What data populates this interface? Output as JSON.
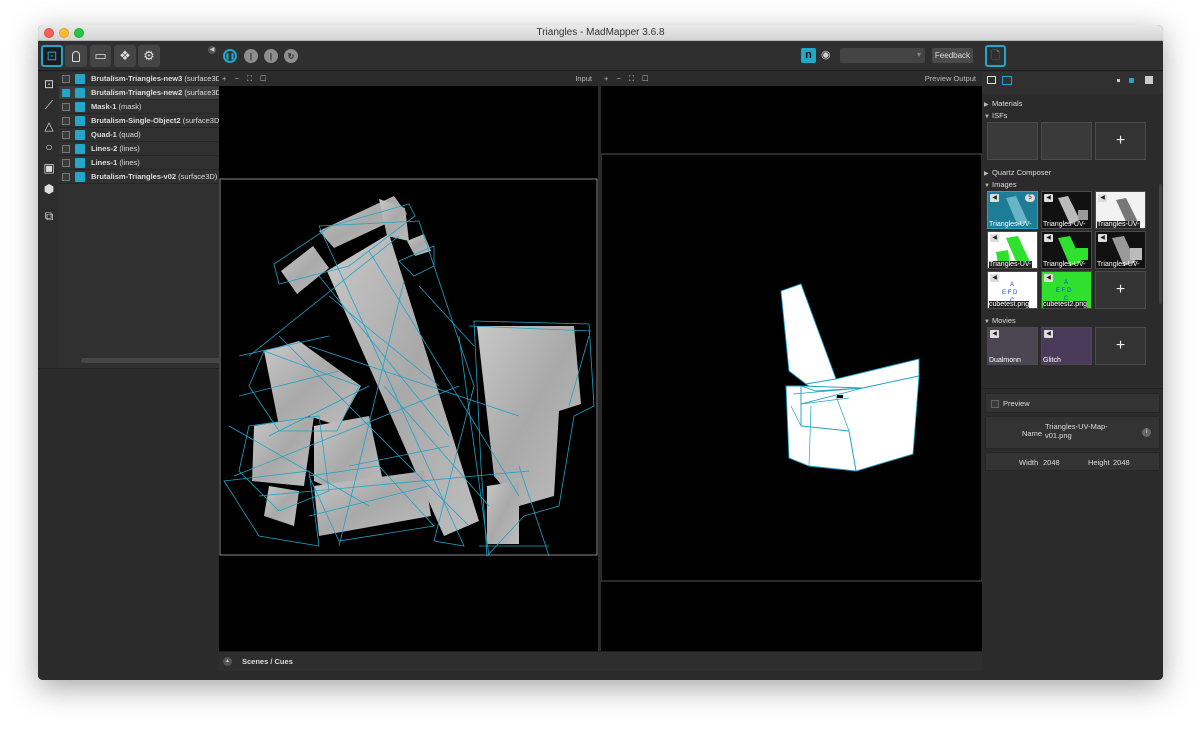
{
  "window": {
    "title": "Triangles - MadMapper 3.6.8"
  },
  "toolbar": {
    "mode_buttons": [
      {
        "icon": "surfaces-icon",
        "glyph": "⊡"
      },
      {
        "icon": "light-bulb-icon",
        "glyph": "💡"
      },
      {
        "icon": "output-device-icon",
        "glyph": "▭"
      },
      {
        "icon": "cubes-icon",
        "glyph": "❖"
      },
      {
        "icon": "gear-icon",
        "glyph": "⚙"
      }
    ],
    "collapse_glyph": "◀",
    "transport": [
      {
        "icon": "pause-icon",
        "glyph": "❚❚"
      },
      {
        "icon": "step-icon",
        "glyph": "|"
      },
      {
        "icon": "step-back-icon",
        "glyph": "|"
      },
      {
        "icon": "loop-icon",
        "glyph": "↻"
      }
    ],
    "brand_glyph": "n",
    "eye_glyph": "◉",
    "output_select": {
      "value": "",
      "chevron": "▾"
    },
    "feedback_label": "Feedback",
    "doc_glyph": "🗋"
  },
  "tools": [
    {
      "icon": "add-quad-icon",
      "glyph": "⊡"
    },
    {
      "icon": "add-line-icon",
      "glyph": "⟋"
    },
    {
      "icon": "add-triangle-icon",
      "glyph": "△"
    },
    {
      "icon": "add-circle-icon",
      "glyph": "○"
    },
    {
      "icon": "add-mask-icon",
      "glyph": "▣"
    },
    {
      "icon": "add-3d-object-icon",
      "glyph": "⬢"
    },
    {
      "icon": "import-icon",
      "glyph": "⧉"
    }
  ],
  "layers": [
    {
      "name": "Brutalism-Triangles-new3",
      "type": "(surface3D)",
      "selected": false
    },
    {
      "name": "Brutalism-Triangles-new2",
      "type": "(surface3D)",
      "selected": true
    },
    {
      "name": "Mask-1",
      "type": "(mask)",
      "selected": false
    },
    {
      "name": "Brutalism-Single-Object2",
      "type": "(surface3D)",
      "selected": false
    },
    {
      "name": "Quad-1",
      "type": "(quad)",
      "selected": false
    },
    {
      "name": "Lines-2",
      "type": "(lines)",
      "selected": false
    },
    {
      "name": "Lines-1",
      "type": "(lines)",
      "selected": false
    },
    {
      "name": "Brutalism-Triangles-v02",
      "type": "(surface3D)",
      "selected": false
    }
  ],
  "input_view": {
    "controls": "+ − ⛶ ☐",
    "label": "Input"
  },
  "output_view": {
    "controls": "+ − ⛶ ☐",
    "label": "Preview Output"
  },
  "scenes": {
    "label": "Scenes / Cues",
    "arrow": "▲"
  },
  "library": {
    "sections": [
      {
        "label": "Materials",
        "open": false
      },
      {
        "label": "ISFs",
        "open": true
      },
      {
        "label": "Quartz Composer",
        "open": false
      },
      {
        "label": "Images",
        "open": true
      },
      {
        "label": "Movies",
        "open": true
      }
    ],
    "images": [
      {
        "label": "Triangles-UV-",
        "badge": "5"
      },
      {
        "label": "Triangles-UV-",
        "badge": ""
      },
      {
        "label": "Triangles-UV-",
        "badge": ""
      },
      {
        "label": "Triangles-UV-",
        "badge": ""
      },
      {
        "label": "Triangles-UV-",
        "badge": ""
      },
      {
        "label": "Triangles-UV-",
        "badge": ""
      },
      {
        "label": "cubetest.png",
        "badge": ""
      },
      {
        "label": "cubetest2.png",
        "badge": ""
      }
    ],
    "movies": [
      {
        "label": "Dualmonn"
      },
      {
        "label": "Glitch"
      }
    ],
    "plus": "+"
  },
  "properties": {
    "preview_label": "Preview",
    "name_key": "Name",
    "name_value_1": "Triangles-UV-Map-",
    "name_value_2": "v01.png",
    "info_glyph": "i",
    "width_key": "Width",
    "width_value": "2048",
    "height_key": "Height",
    "height_value": "2048"
  },
  "colors": {
    "accent": "#22a6c9",
    "background": "#2b2b2b",
    "canvas": "#000000"
  }
}
